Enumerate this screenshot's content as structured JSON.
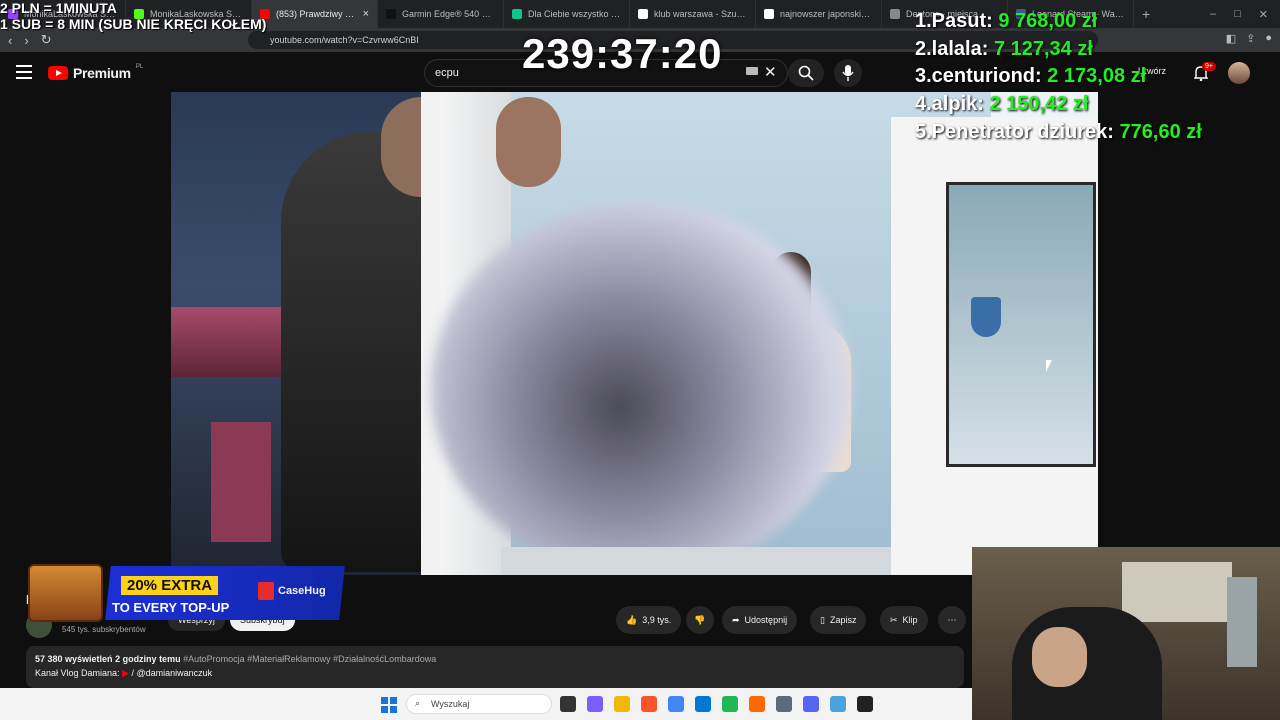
{
  "overlay": {
    "price_line1": "2 PLN = 1MINUTA",
    "price_line2": "1 SUB = 8 MIN (SUB NIE KRĘCI KOŁEM)",
    "timer": "239:37:20",
    "leaderboard": [
      {
        "rank": "1.",
        "name": "Pasut:",
        "amount": "9 768,00 zł"
      },
      {
        "rank": "2.",
        "name": "lalala:",
        "amount": "7 127,34 zł"
      },
      {
        "rank": "3.",
        "name": "centuriond:",
        "amount": "2 173,08 zł"
      },
      {
        "rank": "4.",
        "name": "alpik:",
        "amount": "2 150,42 zł"
      },
      {
        "rank": "5.",
        "name": "Penetrator dziurek:",
        "amount": "776,60 zł"
      }
    ]
  },
  "browser": {
    "tabs": [
      {
        "label": "MonikaLaskowska Stream",
        "color": "#9146ff",
        "active": false
      },
      {
        "label": "MonikaLaskowska Stream",
        "color": "#53fc18",
        "active": false
      },
      {
        "label": "(853) Prawdziwy L...",
        "color": "#ff0000",
        "active": true
      },
      {
        "label": "Garmin Edge® 540 Solar",
        "color": "#111111",
        "active": false
      },
      {
        "label": "Dla Ciebie wszystko - spra",
        "color": "#10c48c",
        "active": false
      },
      {
        "label": "klub warszawa - Szukaj w",
        "color": "#ffffff",
        "active": false
      },
      {
        "label": "najnowszer japonskie sety",
        "color": "#ffffff",
        "active": false
      },
      {
        "label": "Dentons - miejsca",
        "color": "#888888",
        "active": false
      },
      {
        "label": "Leonard Steam - Watch",
        "color": "#3b5998",
        "active": false
      }
    ],
    "url": "youtube.com/watch?v=Czvrww6CnBI"
  },
  "youtube": {
    "brand": "Premium",
    "region": "PL",
    "search_value": "ecpu",
    "create_label": "Utwórz",
    "bell_badge": "9+",
    "channel_title": "Pr",
    "subscribers": "545 tys. subskrybentów",
    "support_label": "Wesprzyj",
    "subscribe_label": "Subskrybuj",
    "like_count": "3,9 tys.",
    "share_label": "Udostępnij",
    "save_label": "Zapisz",
    "clip_label": "Klip",
    "description": {
      "views": "57 380 wyświetleń",
      "age": "2 godziny temu",
      "tags": "#AutoPromocja #MateriałReklamowy #DziałalnośćLombardowa",
      "channel_line_prefix": "Kanał Vlog Damiana:",
      "channel_handle": "/ @damianiwanczuk"
    }
  },
  "promo": {
    "extra": "20% EXTRA",
    "topup": "TO EVERY TOP-UP",
    "brand": "CaseHug"
  },
  "taskbar": {
    "search_placeholder": "Wyszukaj",
    "apps": [
      "file-explorer",
      "copilot",
      "folder",
      "brave",
      "chrome",
      "store",
      "spotify",
      "brave-nightly",
      "calculator",
      "discord",
      "notepad",
      "obs"
    ]
  }
}
